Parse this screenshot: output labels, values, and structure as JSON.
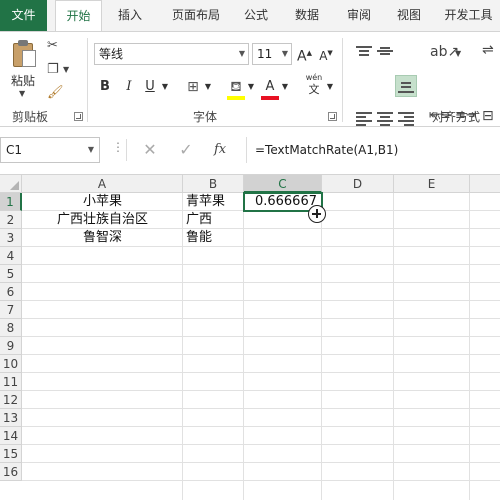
{
  "menu_tabs": [
    "文件",
    "开始",
    "插入",
    "页面布局",
    "公式",
    "数据",
    "审阅",
    "视图",
    "开发工具"
  ],
  "active_tab": "开始",
  "ribbon": {
    "paste_label": "粘贴",
    "clipboard_group": "剪贴板",
    "font_group": "字体",
    "align_group": "对齐方式",
    "font_name": "等线",
    "font_size": "11",
    "bold": "B",
    "italic": "I",
    "underline": "U",
    "grow_font": "A",
    "shrink_font": "A",
    "font_color": "A",
    "phonetic": "wén",
    "phonetic_sub": "文",
    "accent_color": "#217346",
    "font_color_swatch": "#e81123",
    "fill_color_swatch": "#ffff00"
  },
  "formula_bar": {
    "name_box": "C1",
    "fx_label": "fx",
    "formula": "=TextMatchRate(A1,B1)"
  },
  "sheet": {
    "columns": [
      "A",
      "B",
      "C",
      "D",
      "E"
    ],
    "rows": [
      "1",
      "2",
      "3",
      "4",
      "5",
      "6",
      "7",
      "8",
      "9",
      "10",
      "11",
      "12",
      "13",
      "14",
      "15",
      "16"
    ],
    "selected_cell": "C1",
    "cells": {
      "A1": "小苹果",
      "B1": "青苹果",
      "C1": "0.666667",
      "A2": "广西壮族自治区",
      "B2": "广西",
      "A3": "鲁智深",
      "B3": "鲁能"
    }
  }
}
